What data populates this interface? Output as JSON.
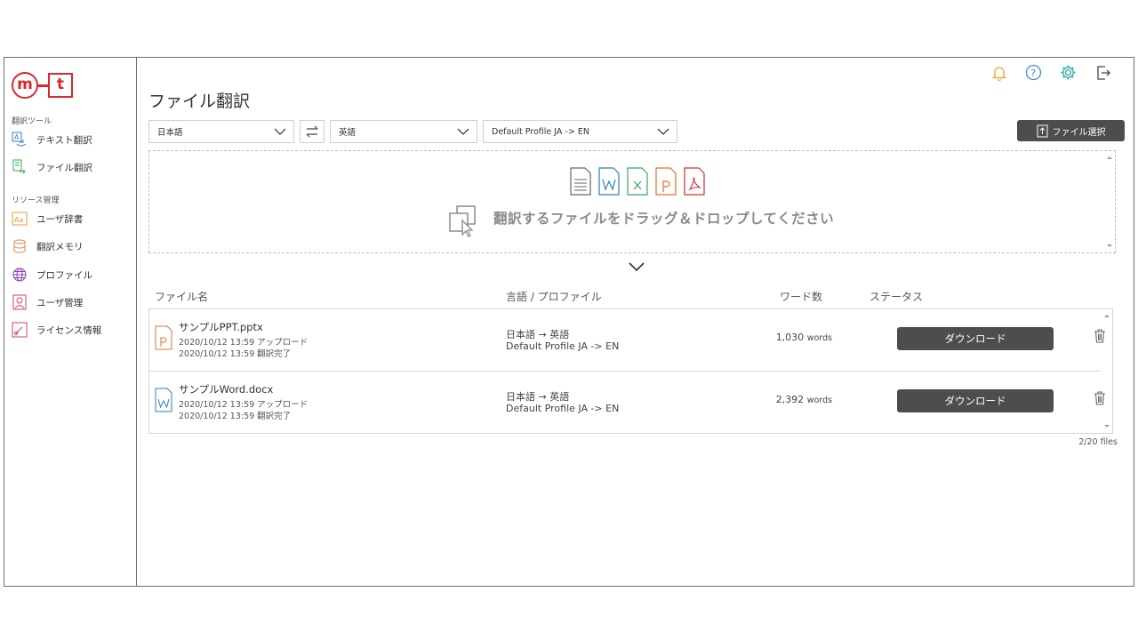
{
  "logo": {
    "m": "m",
    "t": "t"
  },
  "sidebar": {
    "section_translate": "翻訳ツール",
    "section_resources": "リソース管理",
    "items": [
      {
        "label": "テキスト翻訳",
        "icon": "text-translate-icon"
      },
      {
        "label": "ファイル翻訳",
        "icon": "file-translate-icon"
      },
      {
        "label": "ユーザ辞書",
        "icon": "dictionary-icon"
      },
      {
        "label": "翻訳メモリ",
        "icon": "database-icon"
      },
      {
        "label": "プロファイル",
        "icon": "globe-icon"
      },
      {
        "label": "ユーザ管理",
        "icon": "user-icon"
      },
      {
        "label": "ライセンス情報",
        "icon": "license-icon"
      }
    ]
  },
  "header": {
    "title": "ファイル翻訳",
    "icons": [
      "bell-icon",
      "help-icon",
      "gear-icon",
      "logout-icon"
    ]
  },
  "controls": {
    "source_lang": "日本語",
    "target_lang": "英語",
    "profile": "Default Profile JA -> EN",
    "file_select_label": "ファイル選択"
  },
  "dropzone": {
    "text": "翻訳するファイルをドラッグ＆ドロップしてください",
    "file_types": [
      "txt",
      "word",
      "excel",
      "powerpoint",
      "pdf"
    ]
  },
  "table": {
    "headers": {
      "filename": "ファイル名",
      "lang_profile": "言語 / プロファイル",
      "word_count": "ワード数",
      "status": "ステータス"
    },
    "rows": [
      {
        "filename": "サンプルPPT.pptx",
        "type": "powerpoint",
        "uploaded": "2020/10/12 13:59 アップロード",
        "completed": "2020/10/12 13:59 翻訳完了",
        "lang": "日本語 → 英語",
        "profile": "Default Profile JA -> EN",
        "words_num": "1,030",
        "words_unit": "words",
        "action": "ダウンロード"
      },
      {
        "filename": "サンプルWord.docx",
        "type": "word",
        "uploaded": "2020/10/12 13:59 アップロード",
        "completed": "2020/10/12 13:59 翻訳完了",
        "lang": "日本語 → 英語",
        "profile": "Default Profile JA -> EN",
        "words_num": "2,392",
        "words_unit": "words",
        "action": "ダウンロード"
      }
    ]
  },
  "file_count": "2/20 files",
  "colors": {
    "brand_red": "#d8282e",
    "bell": "#f0a020",
    "help": "#3a8fd0",
    "gear": "#2ba8a0",
    "button_dark": "#4d4d4d"
  }
}
